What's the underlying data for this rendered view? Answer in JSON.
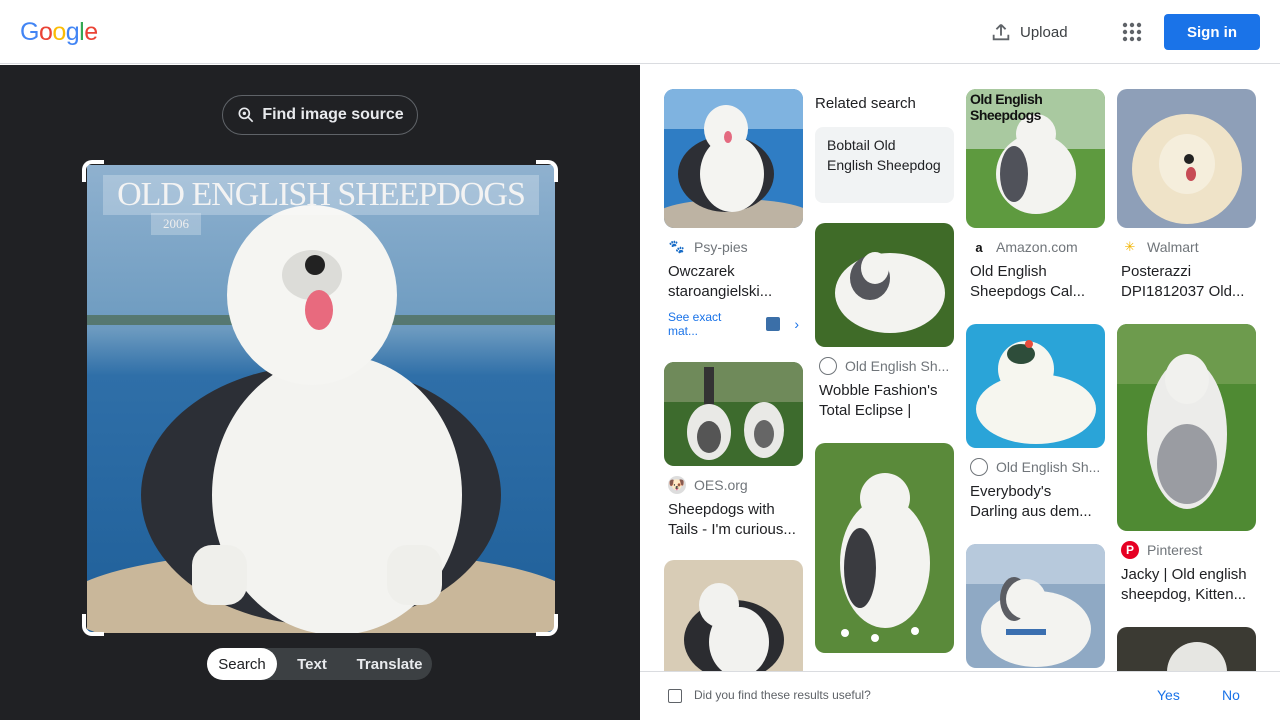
{
  "header": {
    "logo": [
      "G",
      "o",
      "o",
      "g",
      "l",
      "e"
    ],
    "upload_label": "Upload",
    "signin_label": "Sign in"
  },
  "left": {
    "find_label": "Find image source",
    "preview_title": "OLD ENGLISH SHEEPDOGS",
    "preview_year": "2006",
    "tabs": [
      "Search",
      "Text",
      "Translate"
    ],
    "active_tab": "Search"
  },
  "results": {
    "related_title": "Related search",
    "related_chip": "Bobtail Old English Sheepdog",
    "exact_match_label": "See exact mat...",
    "cards": [
      {
        "source": "Psy-pies",
        "desc": "Owczarek staroangielski..."
      },
      {
        "source": "OES.org",
        "desc": "Sheepdogs with Tails - I'm curious..."
      },
      {
        "source": "Old English Sh...",
        "desc": "Wobble Fashion's Total Eclipse | Old..."
      },
      {
        "source": "Amazon.com",
        "desc": "Old English Sheepdogs Cal..."
      },
      {
        "source": "Old English Sh...",
        "desc": "Everybody's Darling aus dem..."
      },
      {
        "source": "Walmart",
        "desc": "Posterazzi DPI1812037 Old..."
      },
      {
        "source": "Pinterest",
        "desc": "Jacky | Old english sheepdog, Kitten..."
      }
    ],
    "calendar_caption": "Old English Sheepdogs"
  },
  "feedback": {
    "question": "Did you find these results useful?",
    "yes": "Yes",
    "no": "No"
  },
  "colors": {
    "accent": "#1a73e8",
    "left_bg": "#202124"
  }
}
